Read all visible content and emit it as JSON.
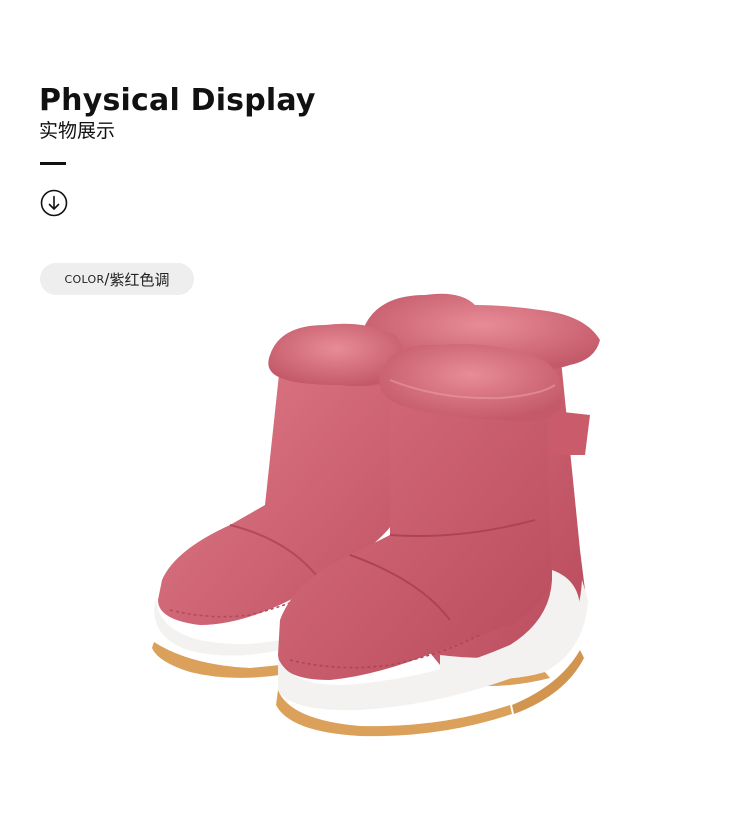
{
  "header": {
    "title": "Physical Display",
    "subtitle": "实物展示"
  },
  "scroll_icon": "arrow-down-circle-icon",
  "color_chip": {
    "key": "COLOR",
    "separator": "/",
    "value": "紫红色调"
  },
  "product_image": "pink-fur-lined-snow-boots",
  "colors": {
    "text": "#111111",
    "chip_bg": "#eeeeee",
    "boot_pink": "#c85a6a",
    "fur": "#d8727f",
    "sole": "#f4f2f0",
    "outsole": "#dba05a"
  }
}
